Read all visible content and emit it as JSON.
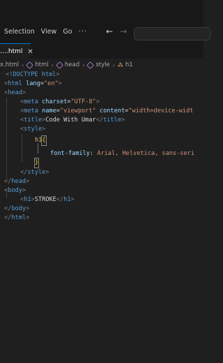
{
  "menu": {
    "items": [
      "Selection",
      "View",
      "Go"
    ],
    "more": "···"
  },
  "nav": {
    "back": "←",
    "forward": "→"
  },
  "tab": {
    "label": "….html",
    "close": "✕"
  },
  "breadcrumb": {
    "file": "x.html",
    "items": [
      "html",
      "head",
      "style"
    ],
    "last": "h1"
  },
  "code": {
    "doctype": "!DOCTYPE html",
    "html_open": "html",
    "lang_attr": "lang",
    "lang_val": "\"en\"",
    "head_open": "head",
    "meta1_tag": "meta",
    "meta1_attr": "charset",
    "meta1_val": "\"UTF-8\"",
    "meta2_tag": "meta",
    "meta2_attr1": "name",
    "meta2_val1": "\"viewport\"",
    "meta2_attr2": "content",
    "meta2_val2": "\"width=device-widt",
    "title_tag": "title",
    "title_text": "Code With Umar",
    "style_tag": "style",
    "selector": "h1",
    "property": "font-family",
    "value": "Arial, Helvetica, sans-seri",
    "style_close": "style",
    "head_close": "head",
    "body_open": "body",
    "h1_tag": "h1",
    "h1_text": "STROKE",
    "body_close": "body",
    "html_close": "html"
  },
  "colors": {
    "background": "#1f1f1f",
    "tag": "#569cd6",
    "attribute": "#9cdcfe",
    "string": "#ce9178",
    "selector": "#d7ba7d",
    "accent": "#0078d4"
  }
}
